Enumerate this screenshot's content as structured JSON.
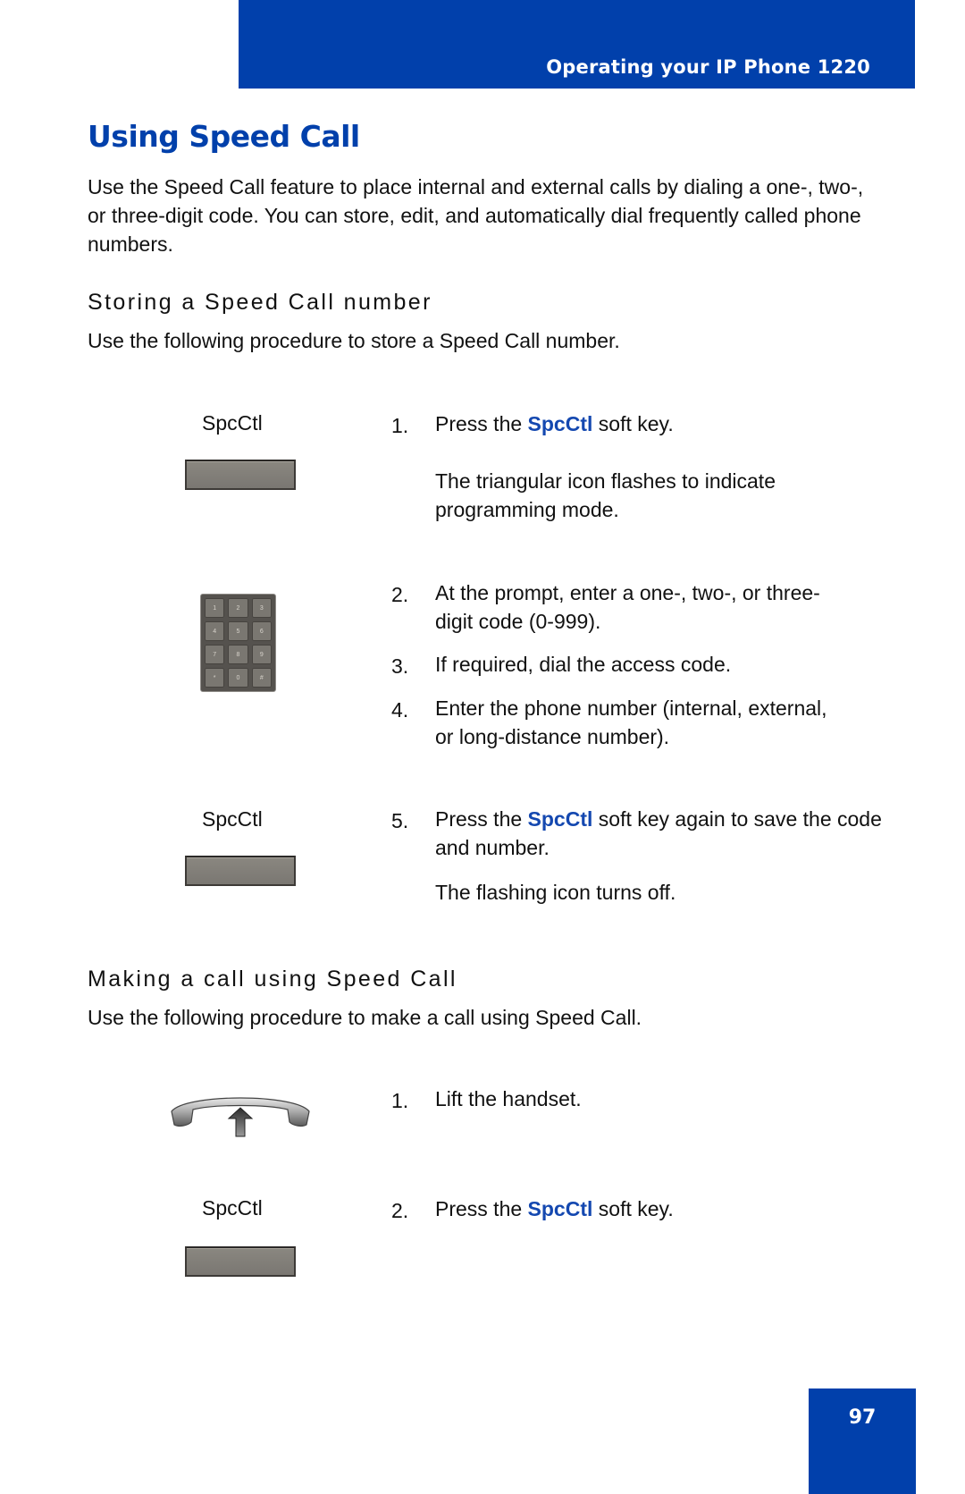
{
  "header": {
    "title": "Operating your IP Phone 1220",
    "color": "#0140ab"
  },
  "page_title": "Using Speed Call",
  "intro": "Use the Speed Call feature to place internal and external calls by dialing a one-, two-, or three-digit code. You can store, edit, and automatically dial frequently called phone numbers.",
  "sections": [
    {
      "heading": "Storing a Speed Call number",
      "subtext": "Use the following procedure to store a Speed Call number.",
      "steps": [
        {
          "num": "1.",
          "pre": "Press the ",
          "key": "SpcCtl",
          "post": " soft key.",
          "note": "The triangular icon flashes to indicate programming mode."
        },
        {
          "num": "2.",
          "text": "At the prompt, enter a one-, two-, or three-digit code (0-999)."
        },
        {
          "num": "3.",
          "text": "If required, dial the access code."
        },
        {
          "num": "4.",
          "text": "Enter the phone number (internal, external, or long-distance number)."
        },
        {
          "num": "5.",
          "pre": "Press the ",
          "key": "SpcCtl",
          "post": " soft key again to save the code and number.",
          "note": "The flashing icon turns off."
        }
      ],
      "icons": [
        {
          "type": "softkey",
          "caption": "SpcCtl"
        },
        {
          "type": "keypad",
          "keys": [
            "1",
            "2",
            "3",
            "4",
            "5",
            "6",
            "7",
            "8",
            "9",
            "*",
            "0",
            "#"
          ]
        },
        {
          "type": "softkey",
          "caption": "SpcCtl"
        }
      ]
    },
    {
      "heading": "Making a call using Speed Call",
      "subtext": "Use the following procedure to make a call using Speed Call.",
      "steps": [
        {
          "num": "1.",
          "text": "Lift the handset."
        },
        {
          "num": "2.",
          "pre": "Press the ",
          "key": "SpcCtl",
          "post": " soft key."
        }
      ],
      "icons": [
        {
          "type": "handset-lift"
        },
        {
          "type": "softkey",
          "caption": "SpcCtl"
        }
      ]
    }
  ],
  "page_number": "97",
  "accent_color": "#1448b0"
}
